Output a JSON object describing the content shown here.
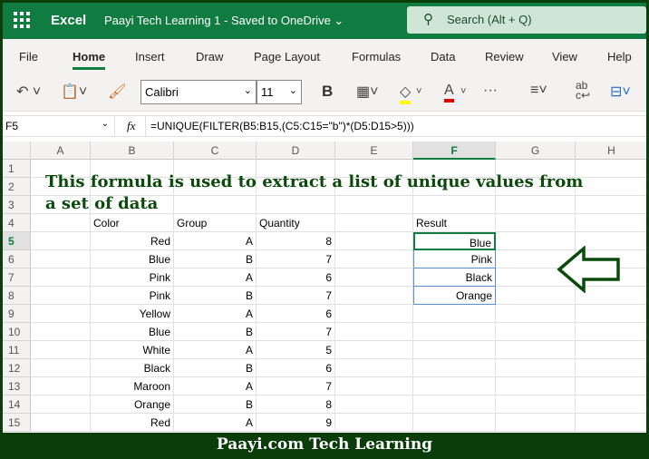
{
  "app": {
    "name": "Excel",
    "document": "Paayi Tech Learning 1  -  Saved to OneDrive",
    "search_placeholder": "Search (Alt + Q)"
  },
  "tabs": [
    "File",
    "Home",
    "Insert",
    "Draw",
    "Page Layout",
    "Formulas",
    "Data",
    "Review",
    "View",
    "Help"
  ],
  "toolbar": {
    "font": "Calibri",
    "size": "11",
    "bold": "B"
  },
  "formula_bar": {
    "name_box": "F5",
    "fx": "fx",
    "formula": "=UNIQUE(FILTER(B5:B15,(C5:C15=\"b\")*(D5:D15>5)))"
  },
  "columns": [
    "A",
    "B",
    "C",
    "D",
    "E",
    "F",
    "G",
    "H"
  ],
  "rows": [
    "1",
    "2",
    "3",
    "4",
    "5",
    "6",
    "7",
    "8",
    "9",
    "10",
    "11",
    "12",
    "13",
    "14",
    "15"
  ],
  "heading_line1": "This formula is used to extract a list of unique values from",
  "heading_line2": "a set of data",
  "headers": {
    "color": "Color",
    "group": "Group",
    "quantity": "Quantity",
    "result": "Result"
  },
  "data": [
    [
      "Red",
      "A",
      "8"
    ],
    [
      "Blue",
      "B",
      "7"
    ],
    [
      "Pink",
      "A",
      "6"
    ],
    [
      "Pink",
      "B",
      "7"
    ],
    [
      "Yellow",
      "A",
      "6"
    ],
    [
      "Blue",
      "B",
      "7"
    ],
    [
      "White",
      "A",
      "5"
    ],
    [
      "Black",
      "B",
      "6"
    ],
    [
      "Maroon",
      "A",
      "7"
    ],
    [
      "Orange",
      "B",
      "8"
    ],
    [
      "Red",
      "A",
      "9"
    ]
  ],
  "result": [
    "Blue",
    "Pink",
    "Black",
    "Orange"
  ],
  "banner": "Paayi.com Tech Learning"
}
